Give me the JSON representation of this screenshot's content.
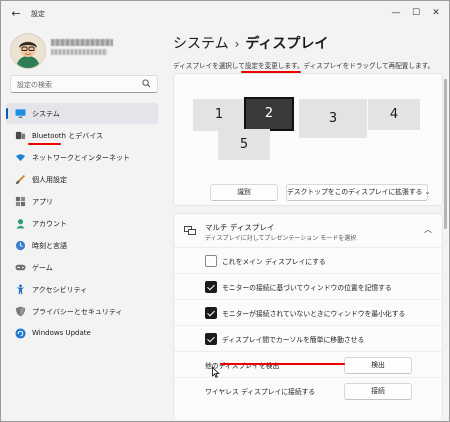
{
  "window": {
    "title": "設定"
  },
  "search": {
    "placeholder": "設定の検索"
  },
  "sidebar": {
    "items": [
      {
        "label": "システム",
        "active": true
      },
      {
        "label": "Bluetooth とデバイス"
      },
      {
        "label": "ネットワークとインターネット"
      },
      {
        "label": "個人用設定"
      },
      {
        "label": "アプリ"
      },
      {
        "label": "アカウント"
      },
      {
        "label": "時刻と言語"
      },
      {
        "label": "ゲーム"
      },
      {
        "label": "アクセシビリティ"
      },
      {
        "label": "プライバシーとセキュリティ"
      },
      {
        "label": "Windows Update"
      }
    ]
  },
  "breadcrumb": {
    "parent": "システム",
    "separator": "›",
    "current": "ディスプレイ"
  },
  "main": {
    "description": "ディスプレイを選択して設定を変更します。ディスプレイをドラッグして再配置します。",
    "monitors": [
      "1",
      "2",
      "3",
      "4",
      "5"
    ],
    "selected_monitor": "2",
    "identify_label": "識別",
    "extend_select": "デスクトップをこのディスプレイに拡張する"
  },
  "multi_display": {
    "title": "マルチ ディスプレイ",
    "subtitle": "ディスプレイに対してプレゼンテーション モードを選択",
    "options": [
      {
        "label": "これをメイン ディスプレイにする",
        "checked": false
      },
      {
        "label": "モニターの接続に基づいてウィンドウの位置を記憶する",
        "checked": true
      },
      {
        "label": "モニターが接続されていないときにウィンドウを最小化する",
        "checked": true
      },
      {
        "label": "ディスプレイ間でカーソルを簡単に移動させる",
        "checked": true
      }
    ],
    "detect_label": "他のディスプレイを検出",
    "detect_button": "検出",
    "wireless_label": "ワイヤレス ディスプレイに接続する",
    "connect_button": "接続"
  },
  "colors": {
    "accent": "#005fb8",
    "highlight": "#e00000"
  }
}
